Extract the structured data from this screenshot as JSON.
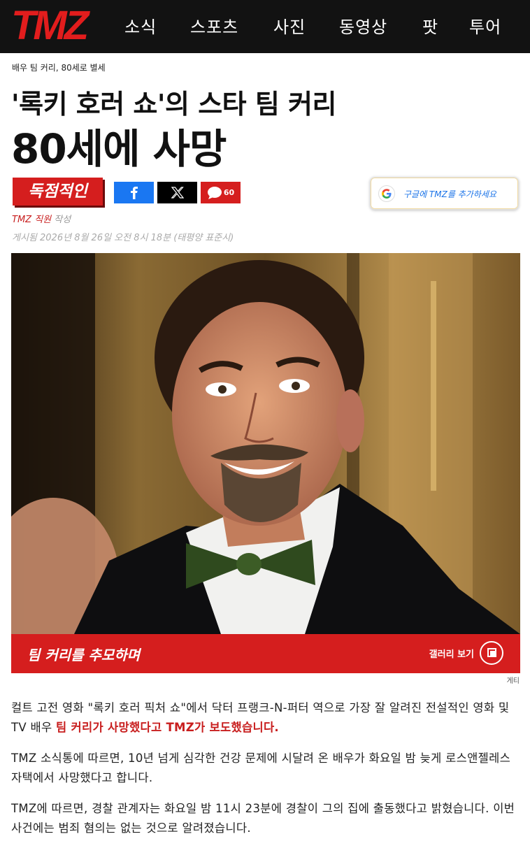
{
  "nav": {
    "logo": "TMZ",
    "items": [
      "소식",
      "스포츠",
      "사진",
      "동영상",
      "팟",
      "투어"
    ]
  },
  "breadcrumb": "배우 팀 커리, 80세로 별세",
  "headline": {
    "line1": "'록키 호러 쇼'의 스타 팀 커리",
    "line2": "80세에 사망"
  },
  "exclusive_label": "독점적인",
  "share": {
    "facebook_icon": "facebook-icon",
    "x_icon": "x-icon",
    "comment_icon": "comment-icon",
    "comment_count": "60"
  },
  "google_button": {
    "label": "구글에 TMZ를 추가하세요"
  },
  "byline": {
    "author": "TMZ 직원",
    "suffix": " 작성",
    "posted": "게시됨 2026년 8월 26일 오전 8시 18분 (태평양 표준시)"
  },
  "photo": {
    "gallery_title": "팀 커리를 추모하며",
    "gallery_link": "갤러리 보기",
    "credit": "게티"
  },
  "article": {
    "p1_before": "컬트 고전 영화 \"록키 호러 픽처 쇼\"에서 닥터 프랭크-N-퍼터 역으로 가장 잘 알려진 전설적인 영화 및 TV 배우 ",
    "p1_highlight": "팀 커리가 사망했다고 TMZ가 보도했습니다.",
    "p2": "TMZ 소식통에 따르면, 10년 넘게 심각한 건강 문제에 시달려 온 배우가 화요일 밤 늦게 로스앤젤레스 자택에서 사망했다고 합니다.",
    "p3": "TMZ에 따르면, 경찰 관계자는 화요일 밤 11시 23분에 경찰이 그의 집에 출동했다고 밝혔습니다. 이번 사건에는 범죄 혐의는 없는 것으로 알려졌습니다."
  },
  "colors": {
    "brand_red": "#d51e1e",
    "nav_bg": "#121212",
    "facebook": "#1a77f2"
  }
}
